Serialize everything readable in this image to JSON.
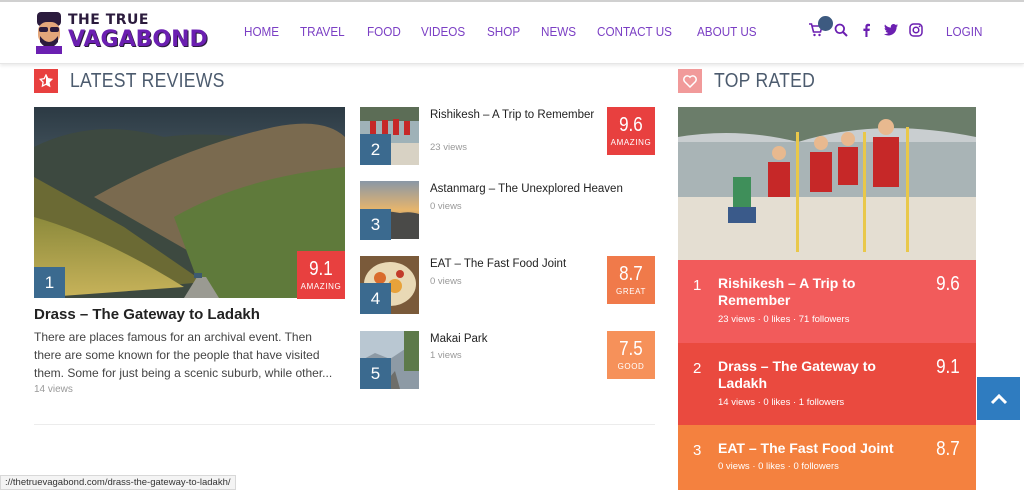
{
  "header": {
    "logo_line1": "THE TRUE",
    "logo_line2": "VAGABOND",
    "nav": [
      "HOME",
      "TRAVEL",
      "FOOD",
      "VIDEOS",
      "SHOP",
      "NEWS",
      "CONTACT US",
      "ABOUT US"
    ],
    "icons": [
      "cart-icon",
      "search-icon",
      "facebook-icon",
      "twitter-icon",
      "instagram-icon"
    ],
    "login": "LOGIN"
  },
  "latest_reviews": {
    "title": "LATEST REVIEWS",
    "feature": {
      "num": "1",
      "score": "9.1",
      "score_label": "AMAZING",
      "title": "Drass – The Gateway to Ladakh",
      "excerpt": "There are places famous for an archival event. Then there are some known for the people that have visited them. Some for just being a scenic suburb, while other...",
      "views": "14 views"
    },
    "items": [
      {
        "num": "2",
        "title": "Rishikesh – A Trip to Remember",
        "views": "23 views",
        "score": "9.6",
        "score_label": "AMAZING"
      },
      {
        "num": "3",
        "title": "Astanmarg – The Unexplored Heaven",
        "views": "0 views",
        "score": "",
        "score_label": ""
      },
      {
        "num": "4",
        "title": "EAT – The Fast Food Joint",
        "views": "0 views",
        "score": "8.7",
        "score_label": "GREAT"
      },
      {
        "num": "5",
        "title": "Makai Park",
        "views": "1 views",
        "score": "7.5",
        "score_label": "GOOD"
      }
    ]
  },
  "top_rated": {
    "title": "TOP RATED",
    "items": [
      {
        "num": "1",
        "title": "Rishikesh – A Trip to Remember",
        "score": "9.6",
        "meta": "23 views   ·   0 likes   ·   71 followers"
      },
      {
        "num": "2",
        "title": "Drass – The Gateway to Ladakh",
        "score": "9.1",
        "meta": "14 views   ·   0 likes   ·   1 followers"
      },
      {
        "num": "3",
        "title": "EAT – The Fast Food Joint",
        "score": "8.7",
        "meta": "0 views   ·   0 likes   ·   0 followers"
      }
    ]
  },
  "status_url": "://thetruevagabond.com/drass-the-gateway-to-ladakh/",
  "colors": {
    "accent_red": "#e8403f",
    "nav_purple": "#7b3fc4",
    "number_blue": "#3b6a8f",
    "score_orange": "#f07a4a",
    "scroll_blue": "#2f7cc0"
  }
}
